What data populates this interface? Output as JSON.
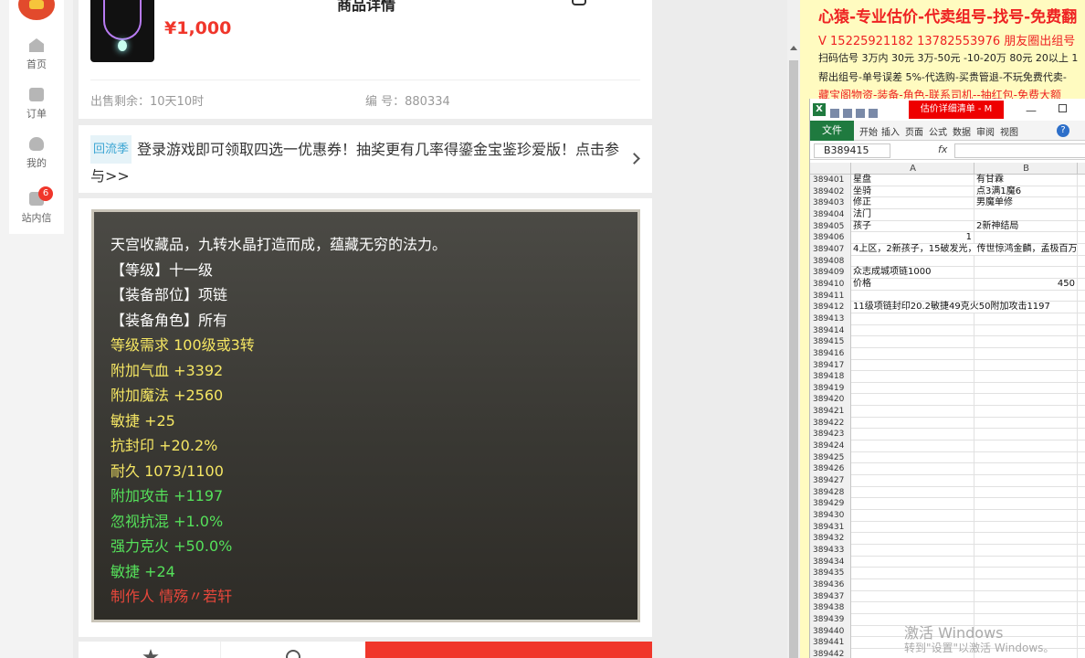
{
  "nav": {
    "items": [
      {
        "label": "首页"
      },
      {
        "label": "订单"
      },
      {
        "label": "我的"
      },
      {
        "label": "站内信",
        "badge": "6"
      }
    ]
  },
  "product": {
    "page_title": "商品详情",
    "price": "¥1,000",
    "remaining": "出售剩余：10天10时",
    "item_id": "编 号：880334",
    "promo_tag": "回流季",
    "promo_text": "登录游戏即可领取四选一优惠券！抽奖更有几率得鎏金宝鉴珍爱版！点击参与>>",
    "attributes": [
      {
        "text": "天宫收藏品，九转水晶打造而成，蕴藏无穷的法力。",
        "color": "#ffffff"
      },
      {
        "text": "【等级】十一级",
        "color": "#ffffff"
      },
      {
        "text": "【装备部位】项链",
        "color": "#ffffff"
      },
      {
        "text": "【装备角色】所有",
        "color": "#ffffff"
      },
      {
        "text": "等级需求 100级或3转",
        "color": "#f5e663"
      },
      {
        "text": "附加气血 +3392",
        "color": "#f5e663"
      },
      {
        "text": "附加魔法 +2560",
        "color": "#f5e663"
      },
      {
        "text": "敏捷 +25",
        "color": "#f5e663"
      },
      {
        "text": "抗封印 +20.2%",
        "color": "#f5e663"
      },
      {
        "text": "耐久 1073/1100",
        "color": "#f5e663"
      },
      {
        "text": "附加攻击 +1197",
        "color": "#55e05a"
      },
      {
        "text": "忽视抗混 +1.0%",
        "color": "#55e05a"
      },
      {
        "text": "强力克火 +50.0%",
        "color": "#55e05a"
      },
      {
        "text": "敏捷 +24",
        "color": "#55e05a"
      },
      {
        "text": "制作人 情殇〃若轩",
        "color": "#e8473b"
      }
    ]
  },
  "ad": {
    "line1": "心猿-专业估价-代卖组号-找号-免费翻",
    "line2": "V 15225921182   13782553976 朋友圈出组号",
    "line3": "扫码估号 3万内 30元 3万-50元 -10-20万 80元 20以上 1",
    "line4": "帮出组号-单号误差 5%-代选购-买贵管退-不玩免费代卖-",
    "line5": "藏宝阁物资-装备-角色-联系司机--抽红包-免费大额"
  },
  "excel": {
    "doc_name": "估价详细清单 - M",
    "file_tab": "文件",
    "tabs": [
      "开始",
      "插入",
      "页面",
      "公式",
      "数据",
      "审阅",
      "视图"
    ],
    "name_box": "B389415",
    "fx": "fx",
    "columns": [
      "A",
      "B"
    ],
    "rows": [
      {
        "n": "389401",
        "a": "星盘",
        "b": "有甘霖"
      },
      {
        "n": "389402",
        "a": "坐骑",
        "b": "点3满1魔6"
      },
      {
        "n": "389403",
        "a": "修正",
        "b": "男魔单修"
      },
      {
        "n": "389404",
        "a": "法门",
        "b": ""
      },
      {
        "n": "389405",
        "a": "孩子",
        "b": "2新神结局"
      },
      {
        "n": "389406",
        "a": "1",
        "b": "",
        "anum": true
      },
      {
        "n": "389407",
        "a": "4上区，2新孩子，15破发光，传世惊鸿金麟，孟极百万",
        "b": "",
        "wide": true
      },
      {
        "n": "389408",
        "a": "",
        "b": ""
      },
      {
        "n": "389409",
        "a": "众志成城项链1000",
        "b": ""
      },
      {
        "n": "389410",
        "a": "价格",
        "b": "450",
        "bnum": true
      },
      {
        "n": "389411",
        "a": "",
        "b": ""
      },
      {
        "n": "389412",
        "a": "11级项链封印20.2敏捷49克火50附加攻击1197",
        "b": "",
        "wide": true
      },
      {
        "n": "389413",
        "a": "",
        "b": ""
      },
      {
        "n": "389414",
        "a": "",
        "b": ""
      },
      {
        "n": "389415",
        "a": "",
        "b": ""
      },
      {
        "n": "389416",
        "a": "",
        "b": ""
      },
      {
        "n": "389417",
        "a": "",
        "b": ""
      },
      {
        "n": "389418",
        "a": "",
        "b": ""
      },
      {
        "n": "389419",
        "a": "",
        "b": ""
      },
      {
        "n": "389420",
        "a": "",
        "b": ""
      },
      {
        "n": "389421",
        "a": "",
        "b": ""
      },
      {
        "n": "389422",
        "a": "",
        "b": ""
      },
      {
        "n": "389423",
        "a": "",
        "b": ""
      },
      {
        "n": "389424",
        "a": "",
        "b": ""
      },
      {
        "n": "389425",
        "a": "",
        "b": ""
      },
      {
        "n": "389426",
        "a": "",
        "b": ""
      },
      {
        "n": "389427",
        "a": "",
        "b": ""
      },
      {
        "n": "389428",
        "a": "",
        "b": ""
      },
      {
        "n": "389429",
        "a": "",
        "b": ""
      },
      {
        "n": "389430",
        "a": "",
        "b": ""
      },
      {
        "n": "389431",
        "a": "",
        "b": ""
      },
      {
        "n": "389432",
        "a": "",
        "b": ""
      },
      {
        "n": "389433",
        "a": "",
        "b": ""
      },
      {
        "n": "389434",
        "a": "",
        "b": ""
      },
      {
        "n": "389435",
        "a": "",
        "b": ""
      },
      {
        "n": "389436",
        "a": "",
        "b": ""
      },
      {
        "n": "389437",
        "a": "",
        "b": ""
      },
      {
        "n": "389438",
        "a": "",
        "b": ""
      },
      {
        "n": "389439",
        "a": "",
        "b": ""
      },
      {
        "n": "389440",
        "a": "",
        "b": ""
      },
      {
        "n": "389441",
        "a": "",
        "b": ""
      },
      {
        "n": "389442",
        "a": "",
        "b": ""
      }
    ]
  },
  "watermark": {
    "line1": "激活 Windows",
    "line2": "转到\"设置\"以激活 Windows。"
  }
}
